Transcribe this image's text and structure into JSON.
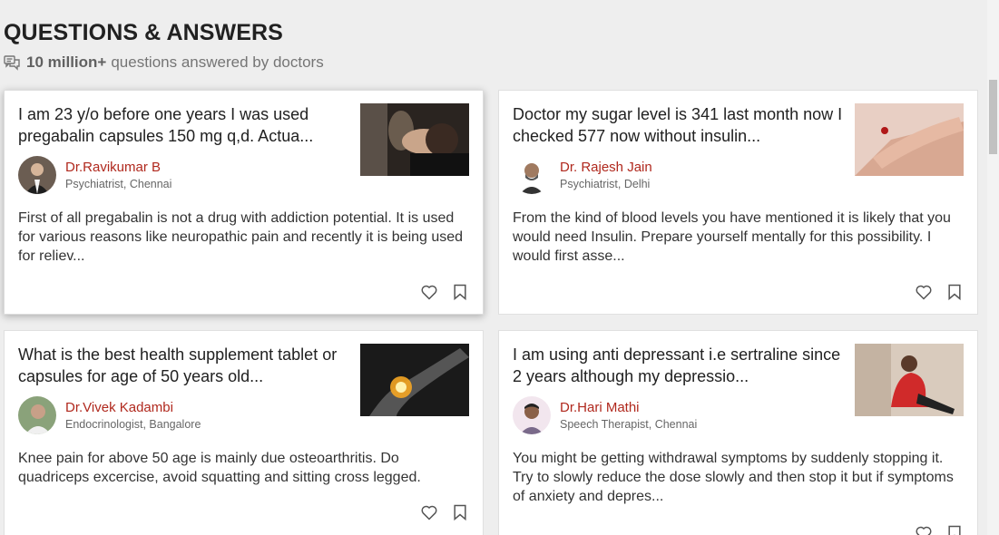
{
  "header": {
    "title": "QUESTIONS & ANSWERS",
    "count": "10 million+",
    "subtitle_rest": "questions answered by doctors"
  },
  "cards": [
    {
      "question": "I am 23 y/o before one years I was used pregabalin capsules 150 mg q,d. Actua...",
      "doctor_name": "Dr.Ravikumar B",
      "doctor_spec": "Psychiatrist, Chennai",
      "answer": "First of all pregabalin is not a drug with addiction potential. It is used for various reasons like neuropathic pain and recently it is being used for reliev..."
    },
    {
      "question": "Doctor my sugar level is 341 last month now I checked 577 now without insulin...",
      "doctor_name": "Dr. Rajesh Jain",
      "doctor_spec": "Psychiatrist, Delhi",
      "answer": "From the kind of blood levels you have mentioned it is likely that you would need Insulin. Prepare yourself mentally for this possibility. I would first asse..."
    },
    {
      "question": "What is the best health supplement tablet or capsules for age of 50 years old...",
      "doctor_name": "Dr.Vivek Kadambi",
      "doctor_spec": "Endocrinologist, Bangalore",
      "answer": "Knee pain for above 50 age is mainly due osteoarthritis. Do quadriceps excercise, avoid squatting and sitting cross legged."
    },
    {
      "question": "I am using anti depressant i.e sertraline since 2 years although my depressio...",
      "doctor_name": "Dr.Hari Mathi",
      "doctor_spec": "Speech Therapist, Chennai",
      "answer": "You might be getting withdrawal symptoms by suddenly stopping it. Try to slowly reduce the dose slowly and then stop it but if symptoms of anxiety and depres..."
    }
  ],
  "colors": {
    "background": "#eeeeee",
    "doctor_name": "#b0281d",
    "card": "#ffffff"
  },
  "icons": [
    "chat-bubbles-icon",
    "heart-icon",
    "bookmark-icon"
  ]
}
